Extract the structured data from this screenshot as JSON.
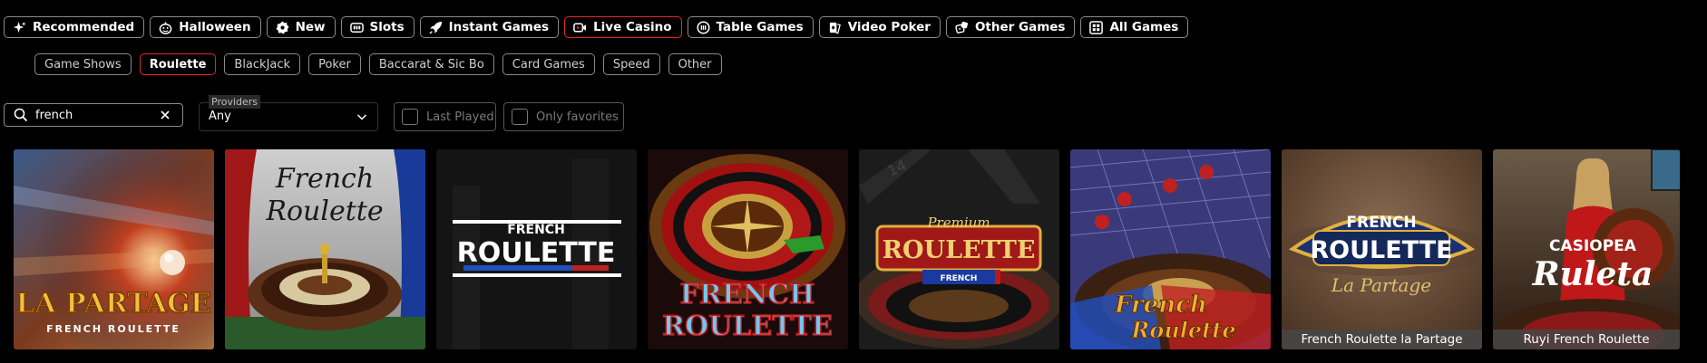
{
  "categories": [
    {
      "label": "Recommended",
      "icon": "sparkle-icon"
    },
    {
      "label": "Halloween",
      "icon": "pumpkin-icon"
    },
    {
      "label": "New",
      "icon": "new-badge-icon"
    },
    {
      "label": "Slots",
      "icon": "slot-machine-icon"
    },
    {
      "label": "Instant Games",
      "icon": "rocket-icon"
    },
    {
      "label": "Live Casino",
      "icon": "live-camera-icon",
      "active": true
    },
    {
      "label": "Table Games",
      "icon": "chip-icon"
    },
    {
      "label": "Video Poker",
      "icon": "cards-icon"
    },
    {
      "label": "Other Games",
      "icon": "dice-icon"
    },
    {
      "label": "All Games",
      "icon": "grid-icon"
    }
  ],
  "subcategories": [
    {
      "label": "Game Shows"
    },
    {
      "label": "Roulette",
      "active": true
    },
    {
      "label": "BlackJack"
    },
    {
      "label": "Poker"
    },
    {
      "label": "Baccarat & Sic Bo"
    },
    {
      "label": "Card Games"
    },
    {
      "label": "Speed"
    },
    {
      "label": "Other"
    }
  ],
  "search": {
    "value": "french",
    "placeholder": ""
  },
  "providers": {
    "label": "Providers",
    "value": "Any"
  },
  "filters": {
    "last_played": "Last Played",
    "only_favorites": "Only favorites"
  },
  "games": [
    {
      "title_line1": "LA PARTAGE",
      "title_line2": "FRENCH ROULETTE",
      "caption": ""
    },
    {
      "title_line1": "French",
      "title_line2": "Roulette",
      "caption": ""
    },
    {
      "title_line1": "FRENCH",
      "title_line2": "ROULETTE",
      "caption": ""
    },
    {
      "title_line1": "FRENCH",
      "title_line2": "ROULETTE",
      "caption": ""
    },
    {
      "title_line1": "Premium",
      "title_line2": "ROULETTE",
      "title_line3": "FRENCH",
      "caption": ""
    },
    {
      "title_line1": "French",
      "title_line2": "Roulette",
      "caption": ""
    },
    {
      "title_line1": "FRENCH",
      "title_line2": "ROULETTE",
      "title_line3": "La Partage",
      "caption": "French Roulette la Partage"
    },
    {
      "title_line1": "CASIOPEA",
      "title_line2": "Ruleta",
      "caption": "Ruyi French Roulette"
    }
  ],
  "colors": {
    "accent": "#e3262a",
    "border": "#8a8a8a",
    "background": "#000000"
  }
}
